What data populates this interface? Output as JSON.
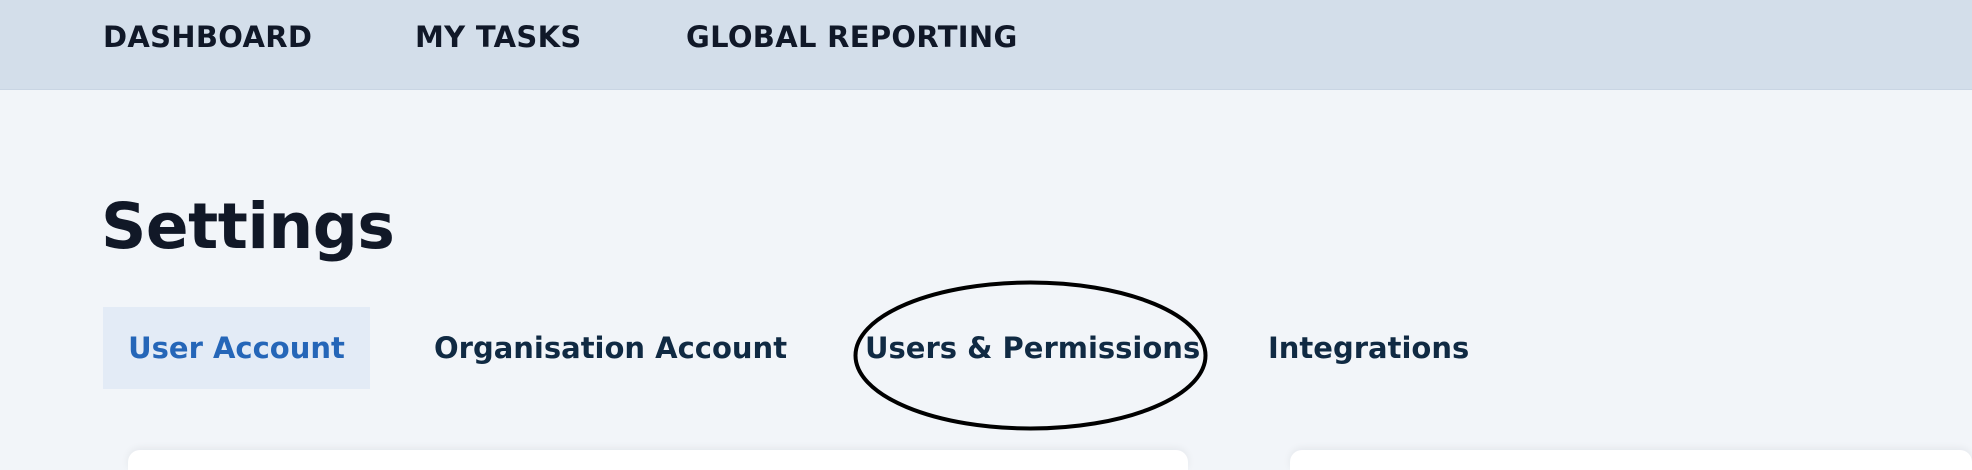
{
  "topnav": {
    "items": [
      {
        "label": "DASHBOARD"
      },
      {
        "label": "MY TASKS"
      },
      {
        "label": "GLOBAL REPORTING"
      }
    ]
  },
  "page": {
    "title": "Settings"
  },
  "tabs": [
    {
      "label": "User Account",
      "active": true
    },
    {
      "label": "Organisation Account",
      "active": false
    },
    {
      "label": "Users & Permissions",
      "active": false,
      "annotated": true
    },
    {
      "label": "Integrations",
      "active": false
    }
  ],
  "colors": {
    "nav_background": "#d3deea",
    "page_background": "#f2f5f9",
    "active_tab_background": "#e3ebf6",
    "active_tab_text": "#2566b8",
    "tab_text": "#102a43",
    "annotation_stroke": "#000000"
  }
}
